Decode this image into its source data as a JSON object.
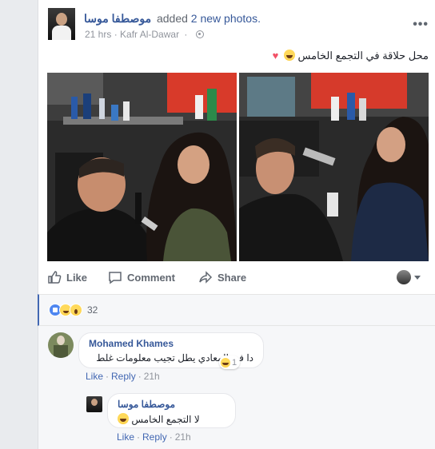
{
  "post": {
    "author": "موصطفا موسا",
    "action_prefix": "added",
    "action_object": "2 new photos.",
    "time": "21 hrs",
    "separator": "·",
    "location": "Kafr Al-Dawar",
    "text": "محل حلاقة في التجمع الخامس",
    "more_label": "•••"
  },
  "actions": {
    "like_label": "Like",
    "comment_label": "Comment",
    "share_label": "Share"
  },
  "reactions": {
    "count": "32",
    "icons": [
      "like-icon",
      "haha-icon",
      "wow-icon"
    ]
  },
  "comments": [
    {
      "author": "Mohamed Khames",
      "text": "دا في المعادي يطل تجيب معلومات غلط",
      "reply_count": "1",
      "like_label": "Like",
      "reply_label": "Reply",
      "time": "21h"
    },
    {
      "author": "موصطفا موسا",
      "text": "لا التجمع الخامس",
      "like_label": "Like",
      "reply_label": "Reply",
      "time": "21h"
    }
  ],
  "colors": {
    "link": "#365899",
    "accent": "#4267b2",
    "meta": "#90949c",
    "background": "#e9ebee"
  }
}
